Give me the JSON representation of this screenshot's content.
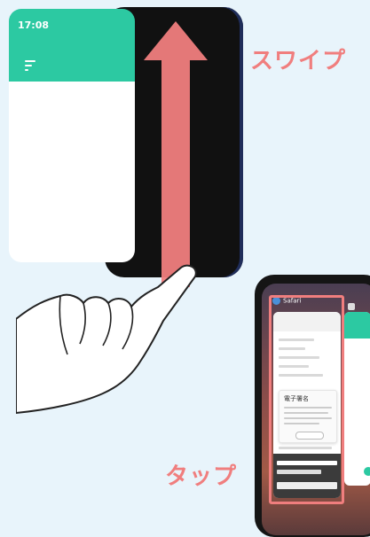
{
  "phone_top": {
    "time": "17:08",
    "header_color": "#2cc9a2"
  },
  "labels": {
    "swipe": "スワイプ",
    "tap": "タップ"
  },
  "phone_bottom": {
    "card1_app": "Safari",
    "modal_title": "電子署名"
  },
  "colors": {
    "accent": "#f07e7e",
    "teal": "#2cc9a2",
    "background": "#e8f4fb"
  },
  "icons": [
    "menu-icon",
    "swipe-arrow-icon",
    "hand-icon",
    "safari-icon"
  ]
}
